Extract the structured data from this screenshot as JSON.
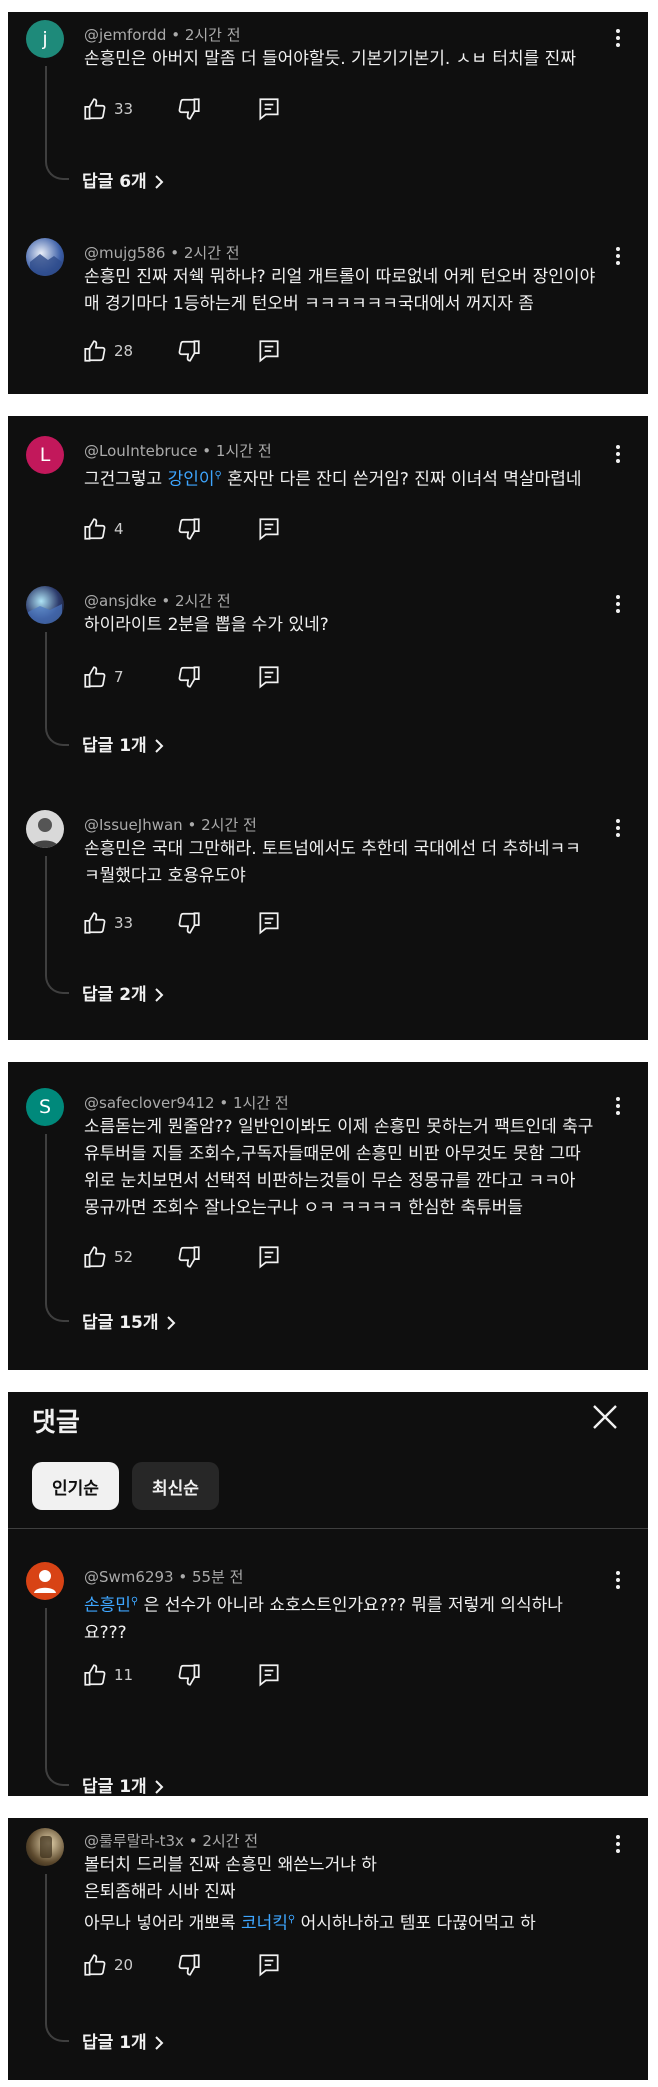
{
  "panels": [
    {
      "comments": [
        {
          "handle": "@jemfordd",
          "time": "2시간 전",
          "avatar_letter": "j",
          "avatar_color": "#1e8a7a",
          "text": [
            "손흥민은 아버지 말좀 더 들어야할듯. 기본기기본기. ㅅㅂ 터치를 진짜"
          ],
          "likes": "33",
          "replies": "답글 6개"
        },
        {
          "handle": "@mujg586",
          "time": "2시간 전",
          "avatar_icon": "photo-avatar",
          "avatar_color": "#3c5fa8",
          "text": [
            "손흥민 진짜 저쉑 뭐하냐? 리얼 개트롤이 따로없네 어케 턴오버 장인이야",
            "매 경기마다 1등하는게 턴오버 ㅋㅋㅋㅋㅋㅋ국대에서 꺼지자 좀"
          ],
          "likes": "28"
        }
      ]
    },
    {
      "comments": [
        {
          "handle": "@LouIntebruce",
          "time": "1시간 전",
          "avatar_letter": "L",
          "avatar_color": "#c2185b",
          "text_pre": "그건그렇고 ",
          "mention": "강인이",
          "text_post": " 혼자만 다른 잔디 쓴거임? 진짜 이녀석 멱살마렵네",
          "likes": "4"
        },
        {
          "handle": "@ansjdke",
          "time": "2시간 전",
          "avatar_icon": "photo-avatar",
          "avatar_color": "#2c3a6b",
          "text": [
            "하이라이트 2분을 뽑을 수가 있네?"
          ],
          "likes": "7",
          "replies": "답글 1개"
        },
        {
          "handle": "@IssueJhwan",
          "time": "2시간 전",
          "avatar_icon": "photo-avatar",
          "avatar_color": "#8a8a8a",
          "text": [
            "손흥민은 국대 그만해라. 토트넘에서도 추한데 국대에선 더 추하네ㅋㅋ",
            "ㅋ뭘했다고 호용유도야"
          ],
          "likes": "33",
          "replies": "답글 2개"
        }
      ]
    },
    {
      "comments": [
        {
          "handle": "@safeclover9412",
          "time": "1시간 전",
          "avatar_letter": "S",
          "avatar_color": "#00897b",
          "text": [
            "소름돋는게 뭔줄암?? 일반인이봐도 이제 손흥민 못하는거 팩트인데 축구",
            "유투버들 지들 조회수,구독자들때문에 손흥민 비판 아무것도 못함 그따",
            "위로 눈치보면서 선택적 비판하는것들이 무슨 정몽규를 깐다고 ㅋㅋ아",
            "몽규까면 조회수 잘나오는구나 ㅇㅋ ㅋㅋㅋㅋ 한심한 축튜버들"
          ],
          "likes": "52",
          "replies": "답글 15개"
        }
      ]
    },
    {
      "header": {
        "title": "댓글",
        "chips": [
          "인기순",
          "최신순"
        ]
      },
      "comments": [
        {
          "handle": "@Swm6293",
          "time": "55분 전",
          "avatar_icon": "person-avatar",
          "avatar_color": "#d84315",
          "mention": "손흥민",
          "text_post": " 은 선수가 아니라 쇼호스트인가요??? 뭐를 저렇게 의식하나",
          "text_line2": "요???",
          "likes": "11",
          "replies": "답글 1개"
        }
      ]
    },
    {
      "comments": [
        {
          "handle": "@룰루랄라-t3x",
          "time": "2시간 전",
          "avatar_icon": "photo-avatar",
          "avatar_color": "#5d4a2e",
          "line1": "볼터치 드리블 진짜 손흥민 왜쓴느거냐 하",
          "line2": "은퇴좀해라 시바 진짜",
          "line3_pre": "아무나 넣어라 개뽀록 ",
          "mention": "코너킥",
          "line3_post": " 어시하나하고 템포 다끊어먹고 하",
          "likes": "20",
          "replies": "답글 1개"
        }
      ]
    }
  ],
  "separator": "•"
}
